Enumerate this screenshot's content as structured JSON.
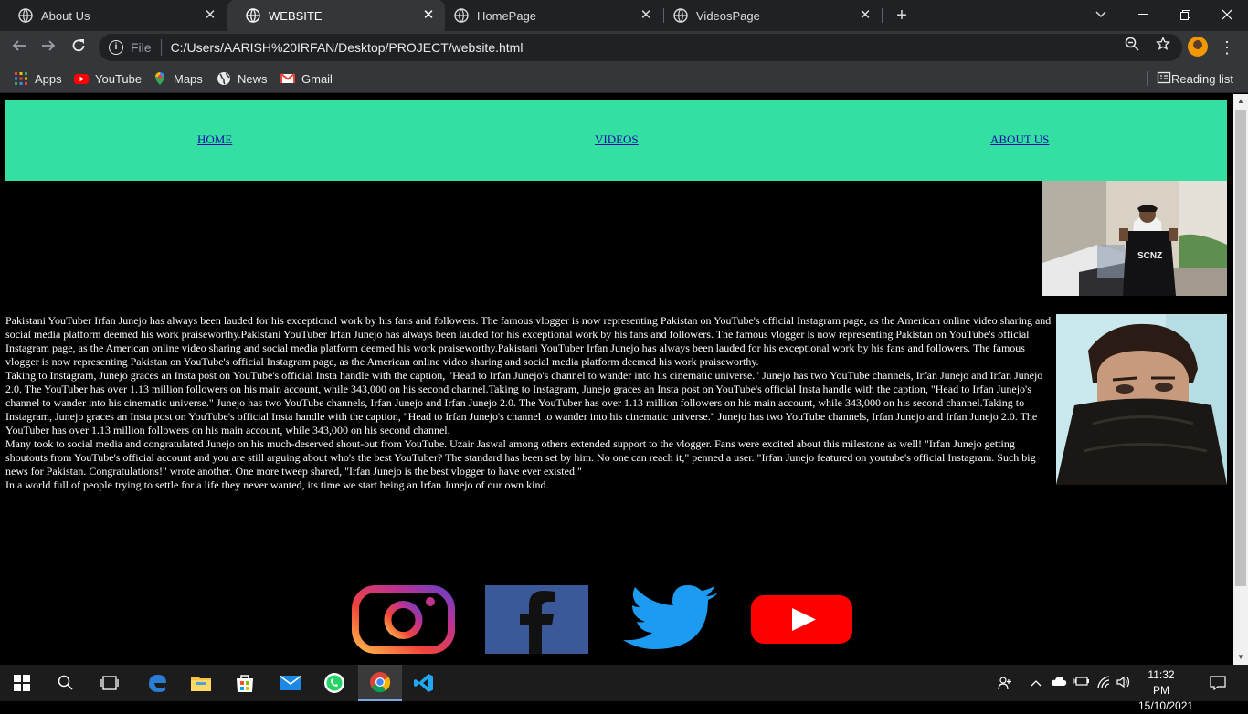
{
  "browser": {
    "tabs": [
      {
        "label": "About Us",
        "active": false
      },
      {
        "label": "WEBSITE",
        "active": true
      },
      {
        "label": "HomePage",
        "active": false
      },
      {
        "label": "VideosPage",
        "active": false
      }
    ],
    "address": {
      "scheme_label": "File",
      "url": "C:/Users/AARISH%20IRFAN/Desktop/PROJECT/website.html"
    },
    "bookmarks": [
      "Apps",
      "YouTube",
      "Maps",
      "News",
      "Gmail"
    ],
    "reading_list": "Reading list"
  },
  "page": {
    "nav": {
      "home": "HOME",
      "videos": "VIDEOS",
      "about": "ABOUT US"
    },
    "photo1_caption": "SCNZ",
    "paragraphs": [
      "Pakistani YouTuber Irfan Junejo has always been lauded for his exceptional work by his fans and followers. The famous vlogger is now representing Pakistan on YouTube's official Instagram page, as the American online video sharing and social media platform deemed his work praiseworthy.Pakistani YouTuber Irfan Junejo has always been lauded for his exceptional work by his fans and followers. The famous vlogger is now representing Pakistan on YouTube's official Instagram page, as the American online video sharing and social media platform deemed his work praiseworthy.Pakistani YouTuber Irfan Junejo has always been lauded for his exceptional work by his fans and followers. The famous vlogger is now representing Pakistan on YouTube's official Instagram page, as the American online video sharing and social media platform deemed his work praiseworthy.",
      "Taking to Instagram, Junejo graces an Insta post on YouTube's official Insta handle with the caption, \"Head to Irfan Junejo's channel to wander into his cinematic universe.\" Junejo has two YouTube channels, Irfan Junejo and Irfan Junejo 2.0. The YouTuber has over 1.13 million followers on his main account, while 343,000 on his second channel.Taking to Instagram, Junejo graces an Insta post on YouTube's official Insta handle with the caption, \"Head to Irfan Junejo's channel to wander into his cinematic universe.\" Junejo has two YouTube channels, Irfan Junejo and Irfan Junejo 2.0. The YouTuber has over 1.13 million followers on his main account, while 343,000 on his second channel.Taking to Instagram, Junejo graces an Insta post on YouTube's official Insta handle with the caption, \"Head to Irfan Junejo's channel to wander into his cinematic universe.\" Junejo has two YouTube channels, Irfan Junejo and Irfan Junejo 2.0. The YouTuber has over 1.13 million followers on his main account, while 343,000 on his second channel.",
      "Many took to social media and congratulated Junejo on his much-deserved shout-out from YouTube. Uzair Jaswal among others extended support to the vlogger. Fans were excited about this milestone as well! \"Irfan Junejo getting shoutouts from YouTube's official account and you are still arguing about who's the best YouTuber? The standard has been set by him. No one can reach it,\" penned a user. \"Irfan Junejo featured on youtube's official Instagram. Such big news for Pakistan. Congratulations!\" wrote another. One more tweep shared, \"Irfan Junejo is the best vlogger to have ever existed.\"",
      "In a world full of people trying to settle for a life they never wanted, its time we start being an Irfan Junejo of our own kind."
    ],
    "social": [
      "instagram",
      "facebook",
      "twitter",
      "youtube"
    ]
  },
  "taskbar": {
    "time": "11:32 PM",
    "date": "15/10/2021"
  },
  "colors": {
    "nav_bg": "#34e0a1",
    "link": "#1a0dab",
    "page_bg": "#000000"
  }
}
